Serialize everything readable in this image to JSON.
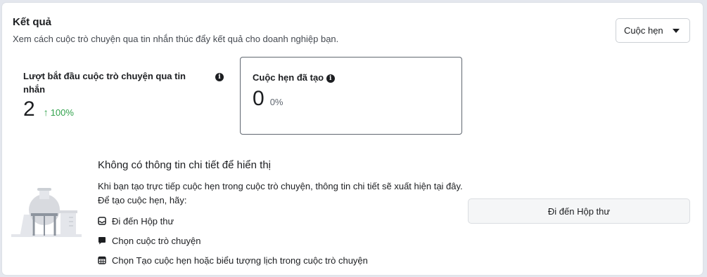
{
  "section": {
    "title": "Kết quả",
    "subtitle": "Xem cách cuộc trò chuyện qua tin nhắn thúc đẩy kết quả cho doanh nghiệp bạn."
  },
  "dropdown": {
    "label": "Cuộc hẹn"
  },
  "metrics": [
    {
      "label": "Lượt bắt đầu cuộc trò chuyện qua tin nhắn",
      "value": "2",
      "change": "100%",
      "change_direction": "up",
      "change_color": "#31a24c"
    },
    {
      "label": "Cuộc hẹn đã tạo",
      "value": "0",
      "change": "0%",
      "selected": true
    }
  ],
  "empty_state": {
    "title": "Không có thông tin chi tiết để hiển thị",
    "description": "Khi bạn tạo trực tiếp cuộc hẹn trong cuộc trò chuyện, thông tin chi tiết sẽ xuất hiện tại đây. Để tạo cuộc hẹn, hãy:",
    "steps": [
      {
        "icon": "inbox-icon",
        "label": "Đi đến Hộp thư"
      },
      {
        "icon": "chat-bubble-icon",
        "label": "Chọn cuộc trò chuyện"
      },
      {
        "icon": "calendar-icon",
        "label": "Chọn Tạo cuộc hẹn hoặc biểu tượng lịch trong cuộc trò chuyện"
      }
    ],
    "button_label": "Đi đến Hộp thư"
  },
  "colors": {
    "positive": "#31a24c",
    "selected_border": "#606770",
    "button_bg": "#f5f6f7"
  }
}
